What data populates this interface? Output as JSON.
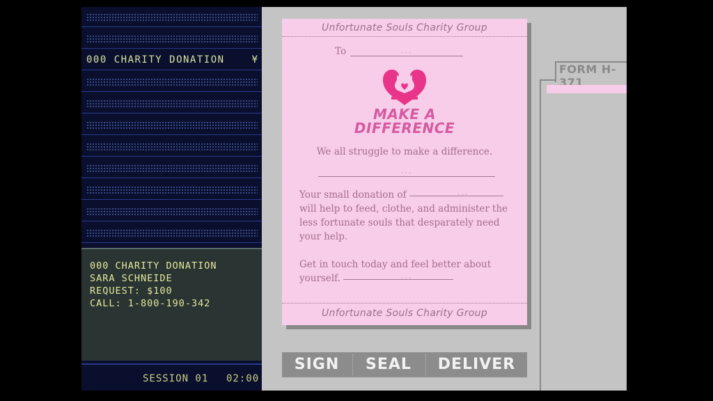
{
  "terminal": {
    "selected_row": {
      "label": "000 CHARITY DONATION",
      "mark": "¥"
    },
    "info_lines": [
      "000 CHARITY DONATION",
      "SARA SCHNEIDE",
      "REQUEST: $100",
      "CALL: 1-800-190-342"
    ],
    "session_label": "SESSION 01",
    "session_time": "02:00"
  },
  "document": {
    "org_top": "Unfortunate Souls Charity Group",
    "to_label": "To",
    "headline_line1": "MAKE A",
    "headline_line2": "DIFFERENCE",
    "tagline": "We all struggle to make a difference.",
    "body_prefix": "Your small donation of",
    "body_rest": "will help to feed, clothe, and administer the less fortunate souls that desparately need your help.",
    "cta_line1": "Get in touch today and feel better about",
    "cta_line2": "yourself.",
    "blank_marker": "...",
    "org_bottom": "Unfortunate Souls Charity Group"
  },
  "buttons": {
    "sign": "SIGN",
    "seal": "SEAL",
    "deliver": "DELIVER"
  },
  "folder": {
    "tab_label": "FORM H-371"
  },
  "colors": {
    "paper": "#f8cdea",
    "heart": "#e8358a",
    "headline": "#d55aa0",
    "terminal_text": "#e3ea9a",
    "terminal_bg": "#0a0f2e",
    "button_bg": "#8c8c8c"
  },
  "icons": {
    "logo": "heart-hands-icon"
  }
}
